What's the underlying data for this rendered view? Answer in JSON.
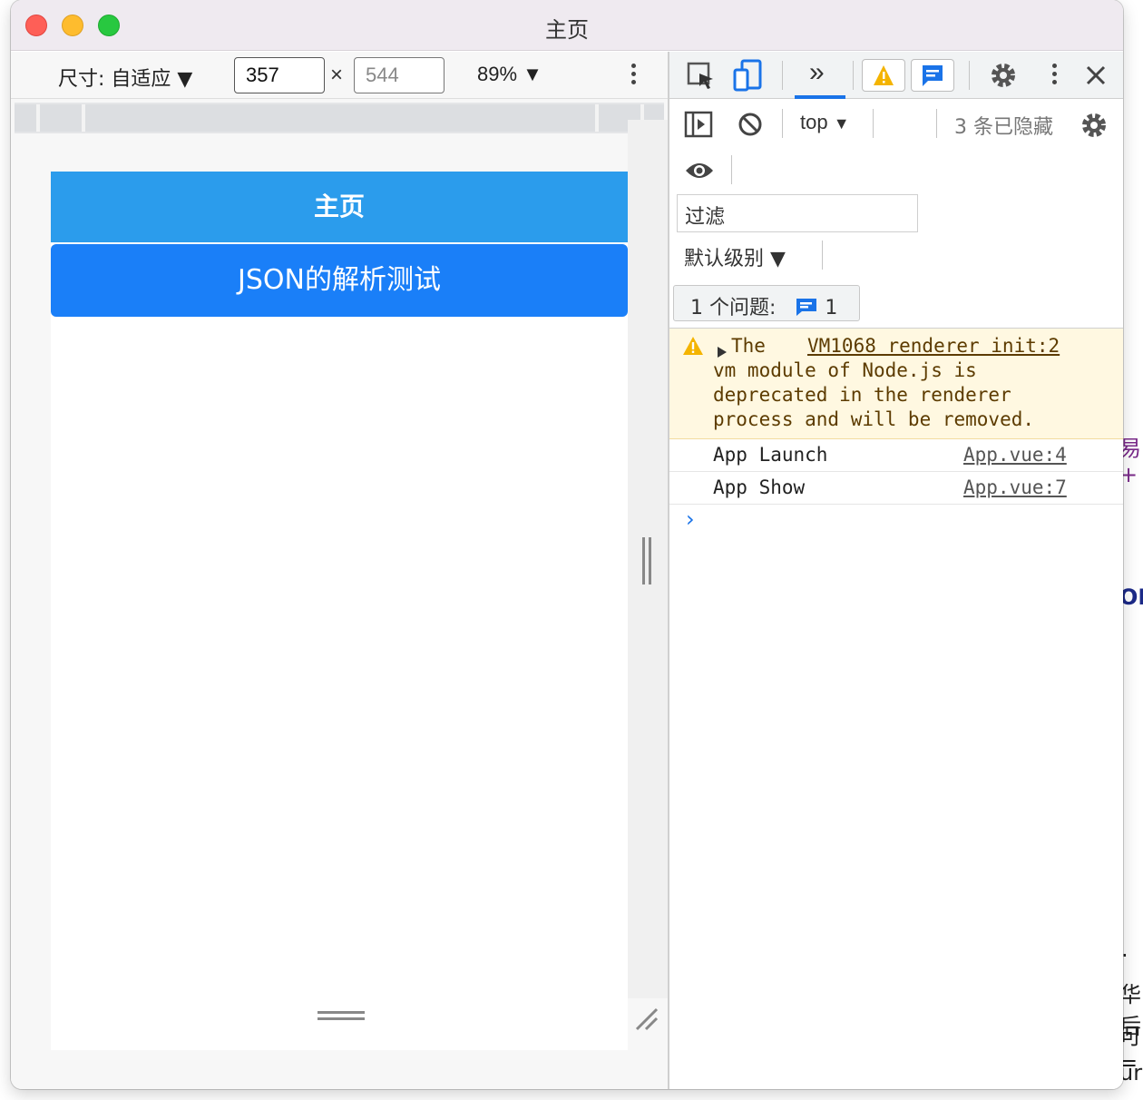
{
  "window": {
    "title": "主页"
  },
  "device_toolbar": {
    "dimensions_label": "尺寸: 自适应 ▼",
    "width_value": "357",
    "height_value": "544",
    "times_symbol": "×",
    "zoom_label": "89% ▼"
  },
  "device_page": {
    "nav_title": "主页",
    "json_button_label": "JSON的解析测试"
  },
  "devtools": {
    "more_tabs_label": "»",
    "context_label": "top",
    "context_arrow": "▼",
    "hidden_count": "3 条已隐藏",
    "filter_placeholder": "过滤",
    "level_label": "默认级别 ▼",
    "issues_label": "1 个问题:",
    "issues_count": "1"
  },
  "console": {
    "warning": {
      "line1": "The",
      "line2": "vm module of Node.js is",
      "line3": "deprecated in the renderer",
      "line4": "process and will be removed.",
      "source": "VM1068 renderer init:2"
    },
    "logs": [
      {
        "message": "App Launch",
        "source": "App.vue:4"
      },
      {
        "message": "App Show",
        "source": "App.vue:7"
      }
    ],
    "prompt": "›"
  },
  "background_fragments": [
    "易+",
    "ON",
    ".",
    "华后",
    "可=",
    "ur"
  ],
  "colors": {
    "nav_blue": "#2b9cec",
    "button_blue": "#1a7ff8",
    "accent": "#1a73e8",
    "warning_bg": "#fff8e1"
  }
}
